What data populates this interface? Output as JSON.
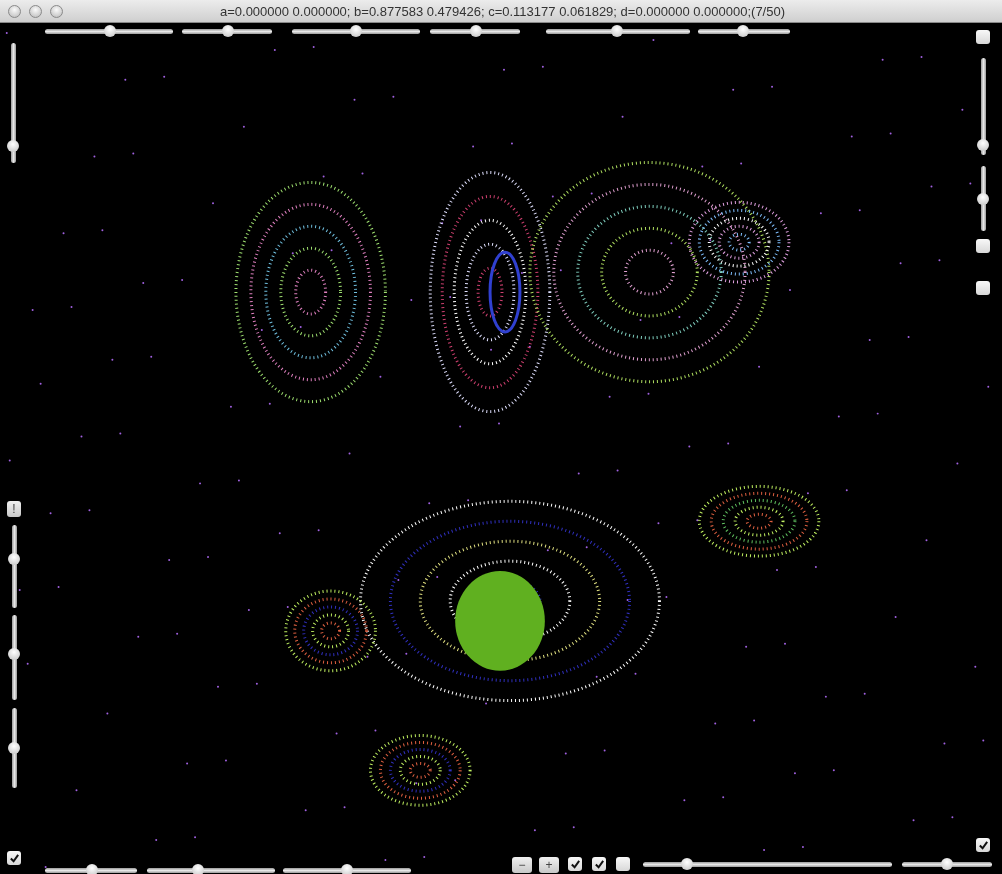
{
  "window": {
    "title": "a=0.000000 0.000000; b=0.877583 0.479426; c=0.113177 0.061829; d=0.000000 0.000000;(7/50)"
  },
  "top_sliders": [
    {
      "level": 0.51
    },
    {
      "level": 0.51
    },
    {
      "level": 0.5
    },
    {
      "level": 0.51
    },
    {
      "level": 0.49
    },
    {
      "level": 0.49
    }
  ],
  "left_upper_slider": {
    "level": 0.1
  },
  "left_controls": [
    {
      "kind": "button",
      "label": "!"
    },
    {
      "kind": "slider",
      "level": 0.6
    },
    {
      "kind": "slider",
      "level": 0.55
    },
    {
      "kind": "slider",
      "level": 0.5
    }
  ],
  "left_checkbox": {
    "checked": true
  },
  "right_controls": [
    {
      "kind": "checkbox",
      "checked": false
    },
    {
      "kind": "slider",
      "level": 0.05
    },
    {
      "kind": "slider",
      "level": 0.5
    },
    {
      "kind": "checkbox",
      "checked": false
    },
    {
      "kind": "checkbox",
      "checked": false
    }
  ],
  "bottom_sliders": [
    {
      "level": 0.51
    },
    {
      "level": 0.39
    },
    {
      "level": 0.5
    }
  ],
  "bottom_controls": [
    {
      "kind": "button",
      "label": "−"
    },
    {
      "kind": "button",
      "label": "+"
    },
    {
      "kind": "checkbox",
      "checked": true
    },
    {
      "kind": "checkbox",
      "checked": true
    },
    {
      "kind": "checkbox",
      "checked": false
    },
    {
      "kind": "slider",
      "level": 0.16
    },
    {
      "kind": "slider",
      "level": 0.5
    }
  ],
  "right_checkbox": {
    "checked": true
  }
}
